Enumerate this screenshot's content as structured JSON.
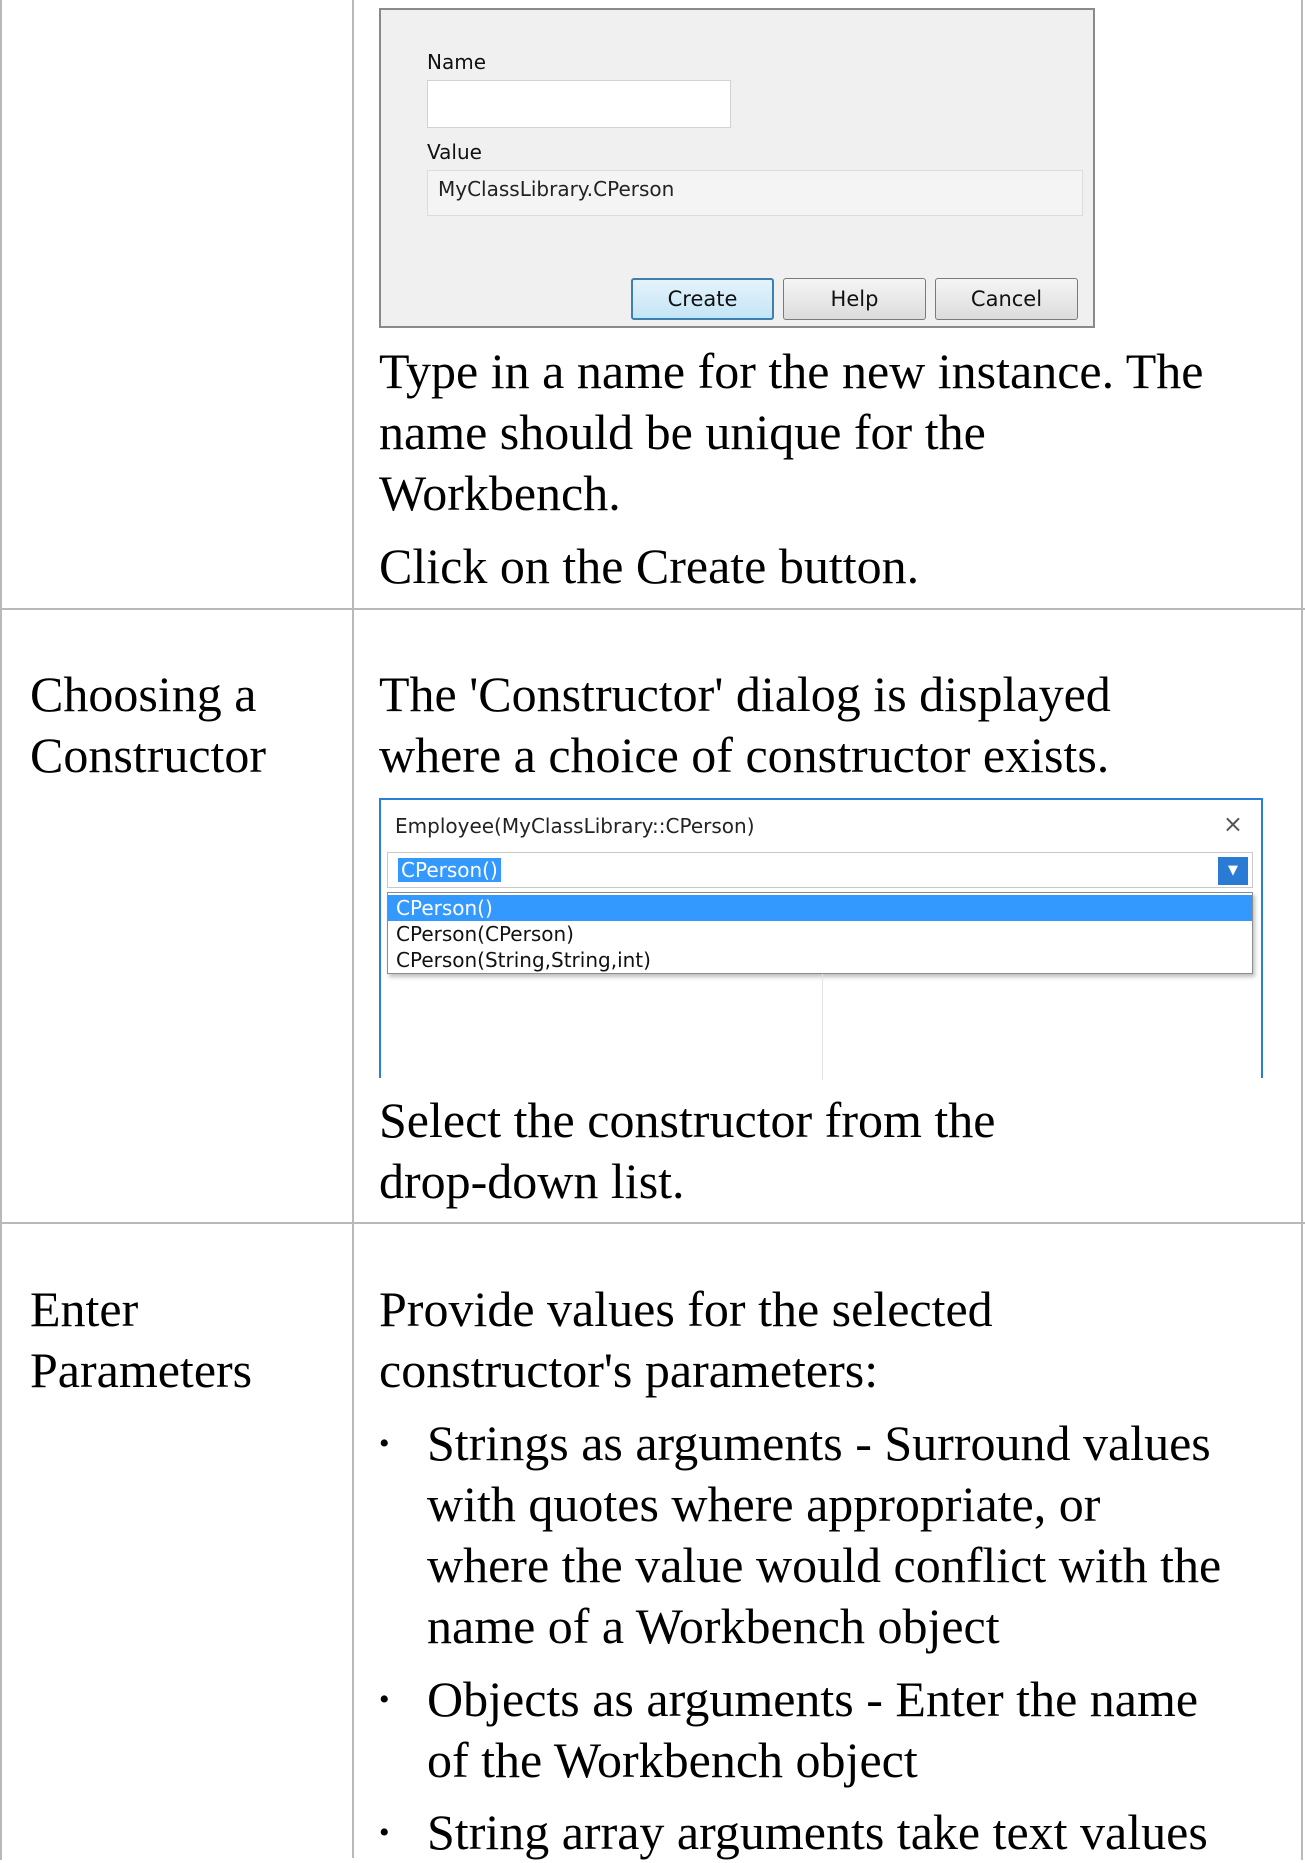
{
  "row1": {
    "dialog": {
      "name_label": "Name",
      "name_value": "",
      "value_label": "Value",
      "value_text": "MyClassLibrary.CPerson",
      "buttons": {
        "create": "Create",
        "help": "Help",
        "cancel": "Cancel"
      }
    },
    "desc_line1": "Type in a name for the new instance. The",
    "desc_line2": "name should be unique for the",
    "desc_line3": "Workbench.",
    "desc_line4": "Click on the Create button."
  },
  "row2": {
    "label_line1": "Choosing a",
    "label_line2": "Constructor",
    "desc_line1": "The 'Constructor' dialog is displayed",
    "desc_line2": "where a choice of constructor exists.",
    "dialog": {
      "title": "Employee(MyClassLibrary::CPerson)",
      "close": "×",
      "selected": "CPerson()",
      "options": [
        "CPerson()",
        "CPerson(CPerson)",
        "CPerson(String,String,int)"
      ]
    },
    "after_line1": "Select the constructor from the",
    "after_line2": "drop-down list."
  },
  "row3": {
    "label_line1": "Enter",
    "label_line2": "Parameters",
    "desc_line1": "Provide values for the selected",
    "desc_line2": "constructor's parameters:",
    "bullets": [
      {
        "lines": [
          "Strings as arguments - Surround values",
          "with quotes where appropriate, or",
          "where the value would conflict with the",
          "name of a Workbench object"
        ]
      },
      {
        "lines": [
          "Objects as arguments - Enter the name",
          "of the Workbench object"
        ]
      },
      {
        "lines": [
          "String array arguments take text values"
        ]
      }
    ]
  }
}
